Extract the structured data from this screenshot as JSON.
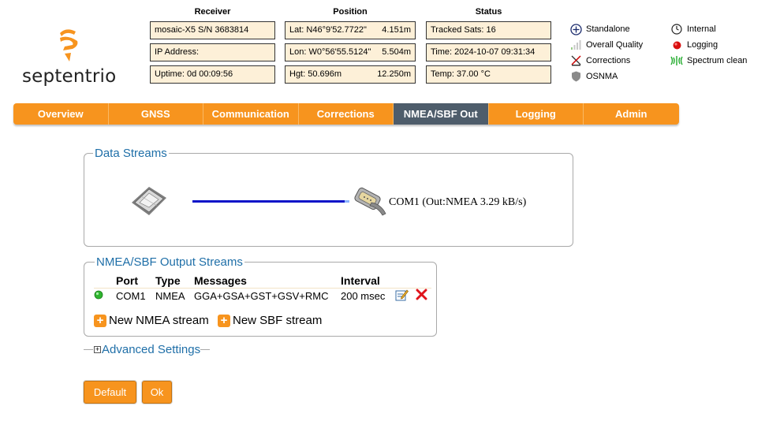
{
  "brand": {
    "name": "septentrio",
    "accent": "#f7941e",
    "nav_active": "#4e5d6b",
    "link": "#1f6fa8"
  },
  "header": {
    "receiver": {
      "title": "Receiver",
      "rows": [
        "mosaic-X5 S/N 3683814",
        "IP Address:",
        "Uptime: 0d 00:09:56"
      ]
    },
    "position": {
      "title": "Position",
      "rows": [
        {
          "left": "Lat:  N46°9'52.7722\"",
          "right": "4.151m"
        },
        {
          "left": "Lon: W0°56'55.5124\"",
          "right": "5.504m"
        },
        {
          "left": "Hgt:  50.696m",
          "right": "12.250m"
        }
      ]
    },
    "status": {
      "title": "Status",
      "rows": [
        "Tracked Sats: 16",
        "Time: 2024-10-07 09:31:34",
        "Temp: 37.00 °C"
      ]
    }
  },
  "legend": {
    "col1": [
      {
        "icon": "crosshair-icon",
        "label": "Standalone"
      },
      {
        "icon": "signal-bars-icon",
        "label": "Overall Quality"
      },
      {
        "icon": "corrections-icon",
        "label": "Corrections"
      },
      {
        "icon": "shield-icon",
        "label": "OSNMA"
      }
    ],
    "col2": [
      {
        "icon": "clock-icon",
        "label": "Internal"
      },
      {
        "icon": "logging-dot-icon",
        "label": "Logging"
      },
      {
        "icon": "spectrum-icon",
        "label": "Spectrum clean"
      }
    ]
  },
  "nav": {
    "tabs": [
      "Overview",
      "GNSS",
      "Communication",
      "Corrections",
      "NMEA/SBF Out",
      "Logging",
      "Admin"
    ],
    "active": "NMEA/SBF Out"
  },
  "data_streams": {
    "title": "Data Streams",
    "source_icon": "receiver-chip-icon",
    "target_icon": "serial-port-icon",
    "target_label": "COM1 (Out:NMEA 3.29 kB/s)"
  },
  "output_streams": {
    "title": "NMEA/SBF Output Streams",
    "columns": [
      "Port",
      "Type",
      "Messages",
      "Interval"
    ],
    "rows": [
      {
        "status": "green-dot-icon",
        "port": "COM1",
        "type": "NMEA",
        "messages": "GGA+GSA+GST+GSV+RMC",
        "interval": "200 msec"
      }
    ],
    "new_nmea": "New NMEA stream",
    "new_sbf": "New SBF stream"
  },
  "advanced": {
    "toggle": "+",
    "label": "Advanced Settings"
  },
  "buttons": {
    "default": "Default",
    "ok": "Ok"
  }
}
